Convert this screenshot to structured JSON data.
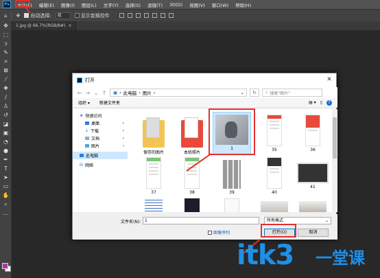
{
  "menubar": {
    "logo": "Ps",
    "items": [
      "文件(F)",
      "编辑(E)",
      "图像(I)",
      "图层(L)",
      "文字(Y)",
      "选择(S)",
      "滤镜(T)",
      "3D(D)",
      "视图(V)",
      "窗口(W)",
      "帮助(H)"
    ]
  },
  "options": {
    "auto_select_label": "自动选择:",
    "auto_select_value": "组",
    "show_transform_label": "显示变换控件"
  },
  "document_tab": {
    "title": "1.jpg @ 66.7%(RGB/8#)",
    "close": "×"
  },
  "dialog": {
    "title": "打开",
    "close": "✕",
    "path": [
      "此电脑",
      "图片"
    ],
    "search_placeholder": "搜索\"图片\"",
    "toolbar": {
      "organize": "组织 ▾",
      "new_folder": "新建文件夹",
      "help": "?"
    },
    "nav": [
      {
        "label": "快速访问",
        "type": "header"
      },
      {
        "label": "桌面",
        "type": "sub",
        "pinned": true
      },
      {
        "label": "下载",
        "type": "sub",
        "pinned": true
      },
      {
        "label": "文档",
        "type": "sub",
        "pinned": true
      },
      {
        "label": "图片",
        "type": "sub",
        "pinned": true
      },
      {
        "label": "此电脑",
        "type": "header",
        "selected": true
      },
      {
        "label": "网络",
        "type": "header"
      }
    ],
    "files": [
      {
        "name": "保存的图片",
        "kind": "folder"
      },
      {
        "name": "本机照片",
        "kind": "folder-red"
      },
      {
        "name": "1",
        "kind": "cat",
        "selected": true
      },
      {
        "name": "35",
        "kind": "phone-red"
      },
      {
        "name": "36",
        "kind": "phone-red2"
      },
      {
        "name": "37",
        "kind": "phone-green"
      },
      {
        "name": "38",
        "kind": "phone-green"
      },
      {
        "name": "39",
        "kind": "grid"
      },
      {
        "name": "40",
        "kind": "phone-dark"
      },
      {
        "name": "41",
        "kind": "wide"
      },
      {
        "name": "",
        "kind": "calendar"
      },
      {
        "name": "",
        "kind": "darkgrid"
      },
      {
        "name": "",
        "kind": "blank"
      },
      {
        "name": "",
        "kind": "photo"
      },
      {
        "name": "",
        "kind": "photo2"
      }
    ],
    "filename_label": "文件名(N):",
    "filename_value": "1",
    "filetype_value": "所有格式",
    "sequence_label": "图像序列",
    "open_label": "打开(O)",
    "cancel_label": "取消"
  },
  "watermark": {
    "text": "itk3",
    "cn": "一堂课"
  },
  "colors": {
    "accent_red": "#e23030",
    "watermark_blue": "#1e90e8",
    "foreground_swatch": "#b535a8"
  }
}
